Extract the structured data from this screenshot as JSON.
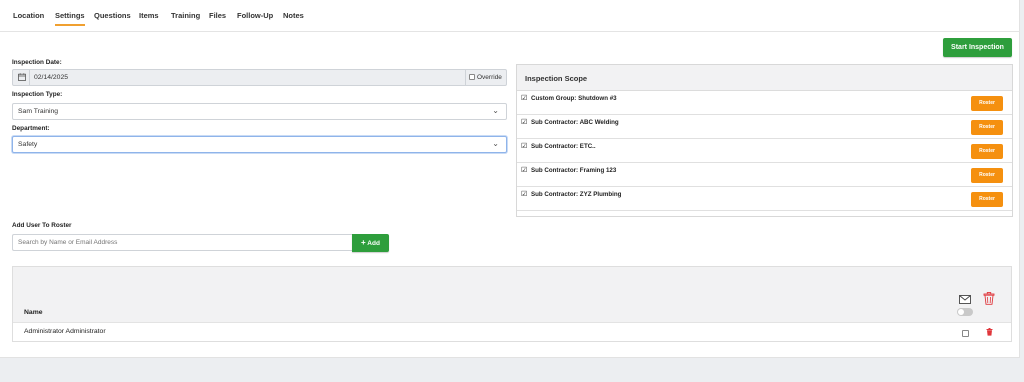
{
  "tabs": [
    "Location",
    "Settings",
    "Questions",
    "Items",
    "Training",
    "Files",
    "Follow-Up",
    "Notes"
  ],
  "active_tab": "Settings",
  "start_inspection_label": "Start Inspection",
  "inspection_date": {
    "label": "Inspection Date:",
    "value": "02/14/2025",
    "override_label": "Override"
  },
  "inspection_type": {
    "label": "Inspection Type:",
    "value": "Sam Training"
  },
  "department": {
    "label": "Department:",
    "value": "Safety"
  },
  "scope": {
    "title": "Inspection Scope",
    "roster_label": "Roster",
    "items": [
      "Custom Group: Shutdown #3",
      "Sub Contractor: ABC Welding",
      "Sub Contractor: ETC..",
      "Sub Contractor: Framing 123",
      "Sub Contractor: ZYZ Plumbing"
    ]
  },
  "add_user": {
    "label": "Add User To Roster",
    "placeholder": "Search by Name or Email Address",
    "button_label": "Add"
  },
  "roster_table": {
    "column_name": "Name",
    "rows": [
      "Administrator Administrator"
    ]
  },
  "colors": {
    "primary_green": "#2e9e3c",
    "roster_orange": "#f5900f",
    "tab_underline": "#f0a030",
    "delete_red": "#e0363b",
    "focus_blue": "#8fb4ea"
  }
}
